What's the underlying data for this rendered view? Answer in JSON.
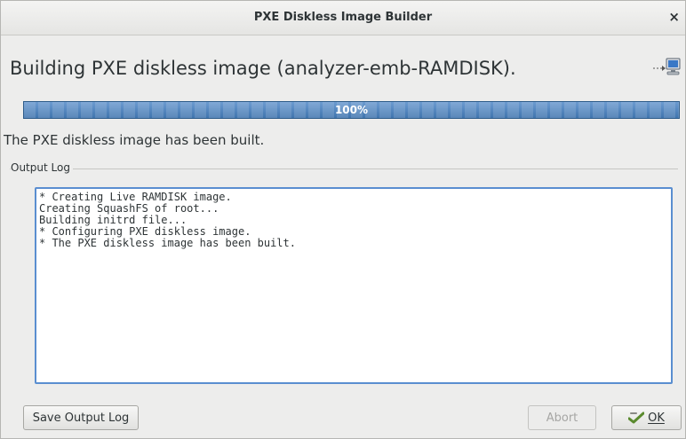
{
  "window": {
    "title": "PXE Diskless Image Builder",
    "close_glyph": "×"
  },
  "heading": "Building PXE diskless image (analyzer-emb-RAMDISK).",
  "heading_icon": "network-computer-icon",
  "progress": {
    "value": 1.0,
    "label": "100%",
    "color": "#4a7fb8"
  },
  "status_text": "The PXE diskless image has been built.",
  "output_log": {
    "group_label": "Output Log",
    "lines": [
      "* Creating Live RAMDISK image.",
      "Creating SquashFS of root...",
      "Building initrd file...",
      "* Configuring PXE diskless image.",
      "* The PXE diskless image has been built."
    ],
    "border_color": "#5a8ed0"
  },
  "buttons": {
    "save_output_log": "Save Output Log",
    "abort": "Abort",
    "ok": "OK",
    "ok_icon": "checkmark-icon"
  }
}
